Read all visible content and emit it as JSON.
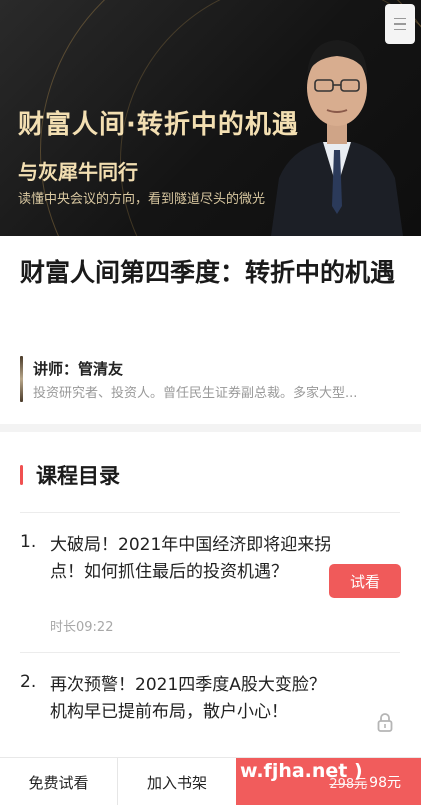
{
  "banner": {
    "title": "财富人间·转折中的机遇",
    "subtitle": "与灰犀牛同行",
    "desc": "读懂中央会议的方向，看到隧道尽头的微光"
  },
  "course": {
    "title": "财富人间第四季度：转折中的机遇"
  },
  "lecturer": {
    "name": "讲师：管清友",
    "desc": "投资研究者、投资人。曾任民生证券副总裁。多家大型..."
  },
  "catalog": {
    "title": "课程目录"
  },
  "lessons": [
    {
      "num": "1.",
      "title": "大破局！2021年中国经济即将迎来拐点！如何抓住最后的投资机遇？",
      "duration": "时长09:22",
      "action": "试看"
    },
    {
      "num": "2.",
      "title": "再次预警！2021四季度A股大变脸？机构早已提前布局，散户小心！"
    }
  ],
  "bottom": {
    "free_trial": "免费试看",
    "add_shelf": "加入书架",
    "watermark": "w.fjha.net )",
    "old_price": "298元",
    "new_price": "98元"
  },
  "colors": {
    "accent": "#f05a5a",
    "banner_gold": "#f3dfb2"
  }
}
